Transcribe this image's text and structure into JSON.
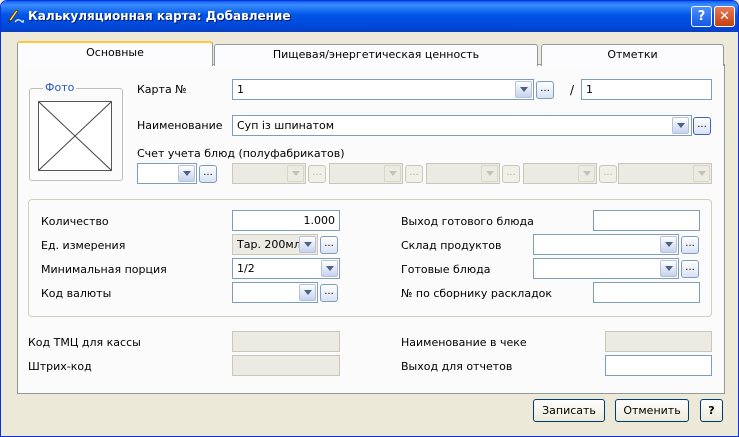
{
  "window": {
    "title": "Калькуляционная карта: Добавление",
    "help_label": "?",
    "close_label": "✕"
  },
  "tabs": [
    {
      "label": "Основные"
    },
    {
      "label": "Пищевая/энергетическая ценность"
    },
    {
      "label": "Отметки"
    }
  ],
  "photo": {
    "label": "Фото"
  },
  "card": {
    "label": "Карта №",
    "value": "1",
    "separator": "/",
    "suffix_value": "1"
  },
  "name": {
    "label": "Наименование",
    "value": "Суп із шпинатом"
  },
  "account": {
    "label": "Счет учета блюд (полуфабрикатов)"
  },
  "qty": {
    "label": "Количество",
    "value": "1.000"
  },
  "unit": {
    "label": "Ед. измерения",
    "value": "Тар. 200мл"
  },
  "minportion": {
    "label": "Минимальная порция",
    "value": "1/2"
  },
  "currency": {
    "label": "Код валюты",
    "value": ""
  },
  "yield": {
    "label": "Выход готового блюда",
    "value": ""
  },
  "warehouse": {
    "label": "Склад продуктов",
    "value": ""
  },
  "ready": {
    "label": "Готовые блюда",
    "value": ""
  },
  "collection": {
    "label": "№ по сборнику раскладок",
    "value": ""
  },
  "tmc": {
    "label": "Код ТМЦ для кассы",
    "value": ""
  },
  "barcode": {
    "label": "Штрих-код",
    "value": ""
  },
  "check_name": {
    "label": "Наименование в чеке",
    "value": ""
  },
  "report_yield": {
    "label": "Выход для отчетов",
    "value": ""
  },
  "buttons": {
    "save": "Записать",
    "cancel": "Отменить",
    "help": "?"
  },
  "ellipsis": "..."
}
